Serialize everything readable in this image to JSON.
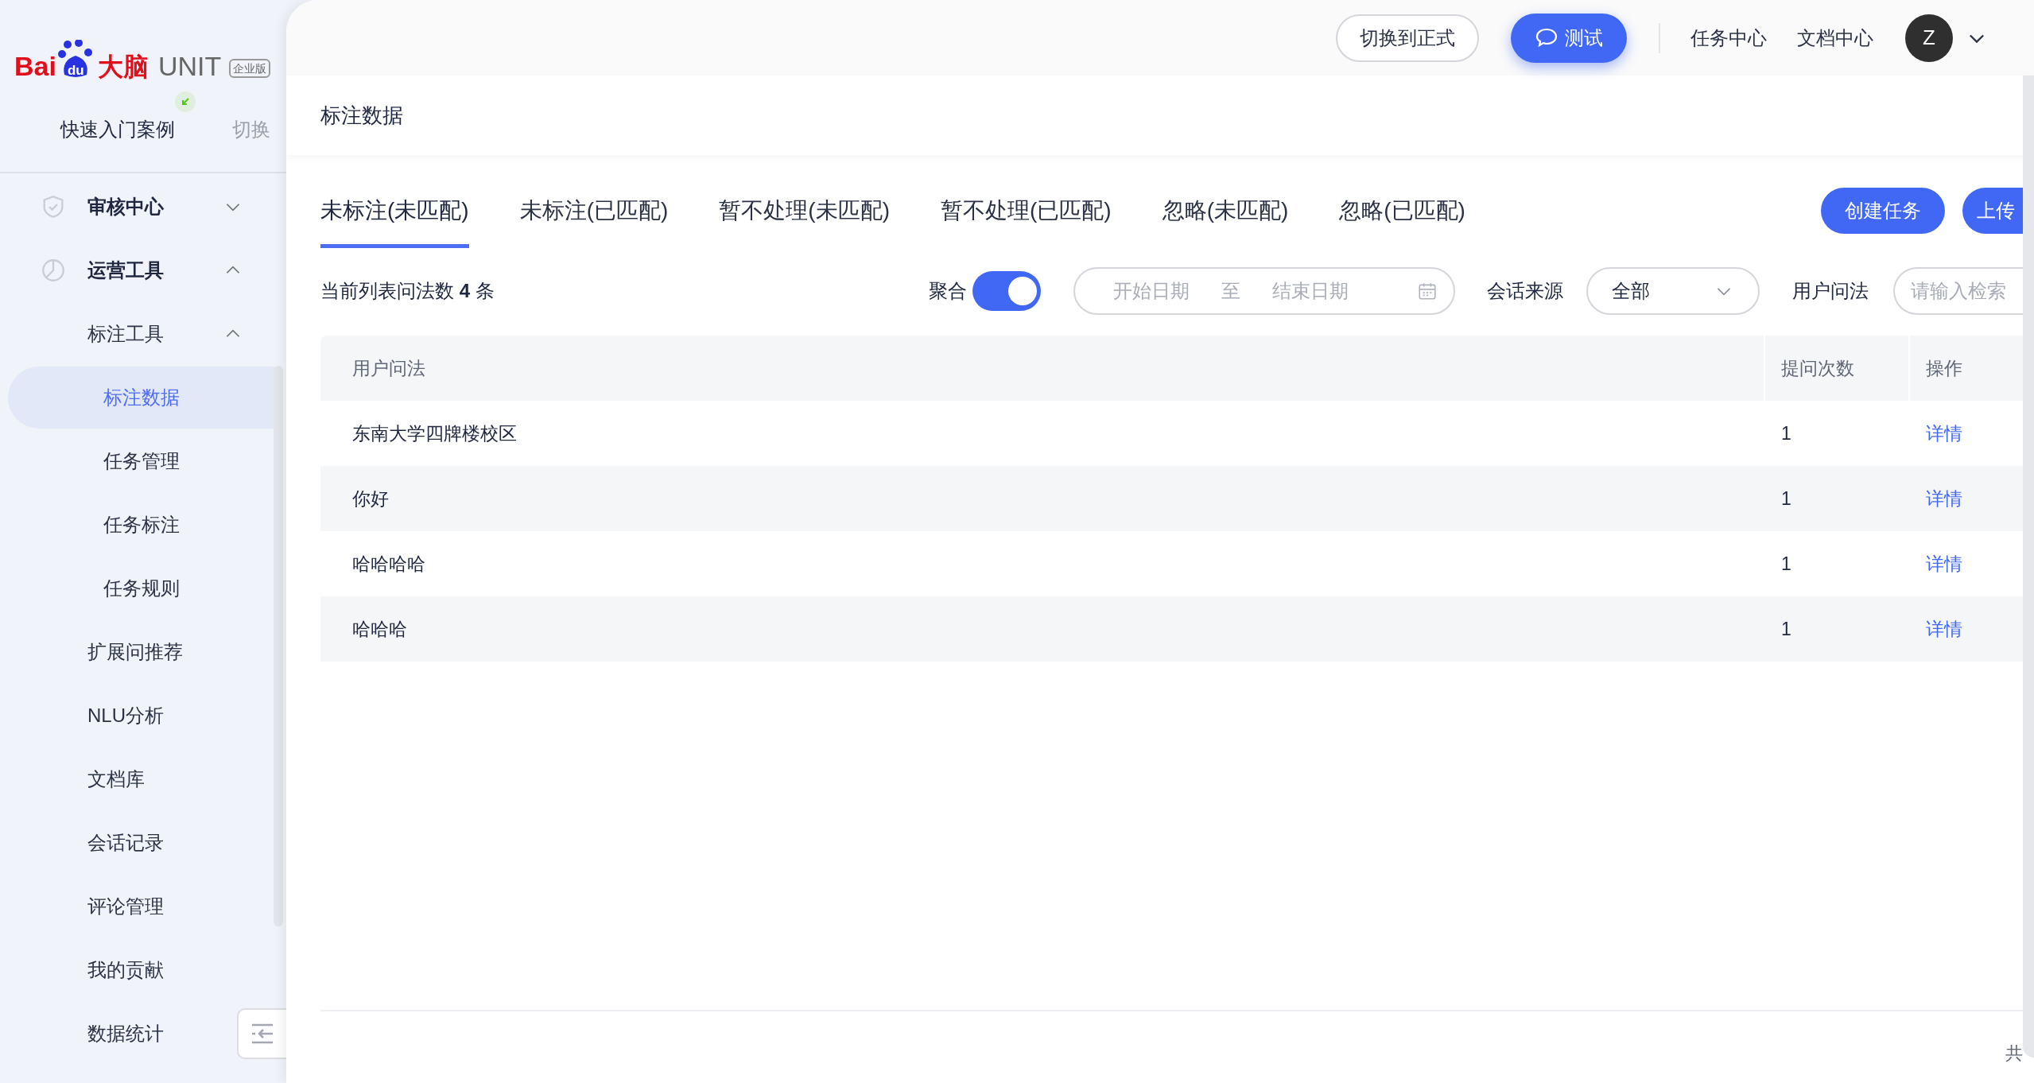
{
  "logo": {
    "brand": "Bai",
    "paw_text": "du",
    "brand_cn": "大脑",
    "product": "UNIT",
    "edition": "企业版"
  },
  "project": {
    "name": "快速入门案例",
    "switch": "切换"
  },
  "sidebar": {
    "items": [
      {
        "label": "审核中心",
        "expanded": false,
        "selected": false
      },
      {
        "label": "运营工具",
        "expanded": true,
        "selected": false,
        "children": [
          {
            "label": "标注工具",
            "expanded": true,
            "selected": false,
            "children": [
              {
                "label": "标注数据",
                "selected": true
              },
              {
                "label": "任务管理",
                "selected": false
              },
              {
                "label": "任务标注",
                "selected": false
              },
              {
                "label": "任务规则",
                "selected": false
              }
            ]
          },
          {
            "label": "扩展问推荐",
            "selected": false
          },
          {
            "label": "NLU分析",
            "selected": false
          },
          {
            "label": "文档库",
            "selected": false
          },
          {
            "label": "会话记录",
            "selected": false
          },
          {
            "label": "评论管理",
            "selected": false
          },
          {
            "label": "我的贡献",
            "selected": false
          },
          {
            "label": "数据统计",
            "selected": false
          }
        ]
      }
    ]
  },
  "topbar": {
    "switch_button": "切换到正式",
    "test_button": "测试",
    "links": [
      "任务中心",
      "文档中心"
    ],
    "avatar": "Z"
  },
  "page_title": "标注数据",
  "tabs": [
    {
      "label": "未标注(未匹配)",
      "selected": true
    },
    {
      "label": "未标注(已匹配)",
      "selected": false
    },
    {
      "label": "暂不处理(未匹配)",
      "selected": false
    },
    {
      "label": "暂不处理(已匹配)",
      "selected": false
    },
    {
      "label": "忽略(未匹配)",
      "selected": false
    },
    {
      "label": "忽略(已匹配)",
      "selected": false
    }
  ],
  "actions": [
    "创建任务",
    "上传"
  ],
  "toolbar": {
    "count": "当前列表问法数 **4** 条",
    "aggregate": {
      "label": "聚合",
      "on": true
    },
    "date_range": {
      "start_placeholder": "开始日期",
      "separator": "至",
      "end_placeholder": "结束日期"
    },
    "source": {
      "label": "会话来源",
      "value": "全部"
    },
    "query": {
      "label": "用户问法",
      "placeholder": "请输入检索"
    }
  },
  "table": {
    "columns": [
      "用户问法",
      "提问次数",
      "操作"
    ],
    "rows": [
      {
        "query": "东南大学四牌楼校区",
        "count": "1",
        "action": "详情"
      },
      {
        "query": "你好",
        "count": "1",
        "action": "详情"
      },
      {
        "query": "哈哈哈哈",
        "count": "1",
        "action": "详情"
      },
      {
        "query": "哈哈哈",
        "count": "1",
        "action": "详情"
      }
    ]
  },
  "footer": {
    "total": "共"
  }
}
